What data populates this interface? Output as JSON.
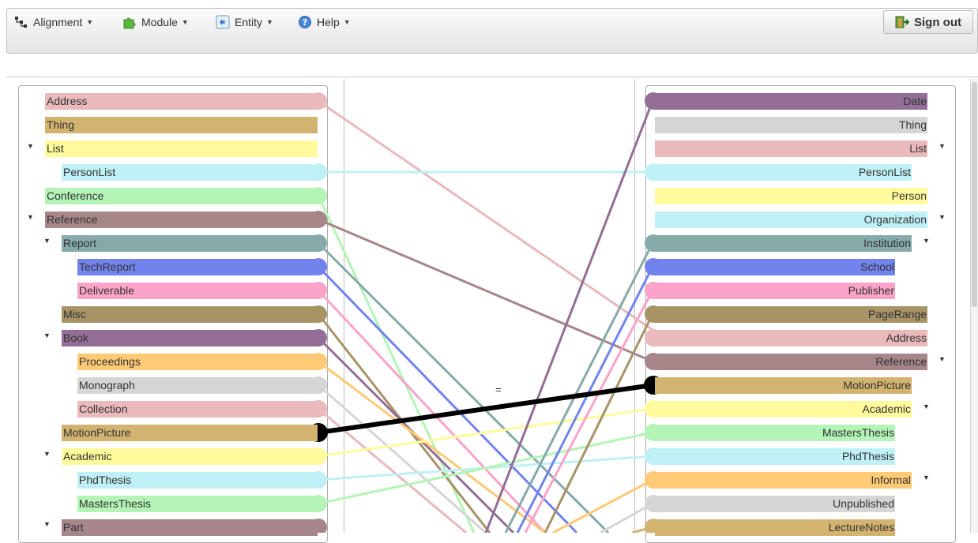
{
  "toolbar": {
    "menus": [
      {
        "label": "Alignment",
        "icon": "alignment-tree-icon"
      },
      {
        "label": "Module",
        "icon": "puzzle-piece-icon"
      },
      {
        "label": "Entity",
        "icon": "entity-icon"
      },
      {
        "label": "Help",
        "icon": "help-icon"
      }
    ],
    "sign_out": {
      "label": "Sign out",
      "icon": "exit-door-icon"
    }
  },
  "mapping_label": "=",
  "colors": {
    "pink": "#e9b9bb",
    "gold": "#d3b370",
    "yellow": "#fffa9c",
    "cyan": "#bff0f5",
    "green": "#b4f4b6",
    "mauve": "#a68689",
    "teal": "#86aaaa",
    "blue": "#7283ee",
    "rose": "#fba3c9",
    "olive": "#a79366",
    "purple": "#946e96",
    "orange": "#ffca75",
    "grey": "#d5d5d5"
  },
  "left_tree": [
    {
      "label": "Address",
      "color": "pink",
      "toggle": false
    },
    {
      "label": "Thing",
      "color": "gold",
      "toggle": false
    },
    {
      "label": "List",
      "color": "yellow",
      "toggle": true
    },
    {
      "label": "PersonList",
      "color": "cyan",
      "toggle": false
    },
    {
      "label": "Conference",
      "color": "green",
      "toggle": false
    },
    {
      "label": "Reference",
      "color": "mauve",
      "toggle": true
    },
    {
      "label": "Report",
      "color": "teal",
      "toggle": true
    },
    {
      "label": "TechReport",
      "color": "blue",
      "toggle": false
    },
    {
      "label": "Deliverable",
      "color": "rose",
      "toggle": false
    },
    {
      "label": "Misc",
      "color": "olive",
      "toggle": false
    },
    {
      "label": "Book",
      "color": "purple",
      "toggle": true
    },
    {
      "label": "Proceedings",
      "color": "orange",
      "toggle": false
    },
    {
      "label": "Monograph",
      "color": "grey",
      "toggle": false
    },
    {
      "label": "Collection",
      "color": "pink",
      "toggle": false
    },
    {
      "label": "MotionPicture",
      "color": "gold",
      "toggle": false
    },
    {
      "label": "Academic",
      "color": "yellow",
      "toggle": true
    },
    {
      "label": "PhdThesis",
      "color": "cyan",
      "toggle": false
    },
    {
      "label": "MastersThesis",
      "color": "green",
      "toggle": false
    },
    {
      "label": "Part",
      "color": "mauve",
      "toggle": true
    }
  ],
  "right_tree": [
    {
      "label": "Date",
      "color": "purple",
      "toggle": false
    },
    {
      "label": "Thing",
      "color": "grey",
      "toggle": false
    },
    {
      "label": "List",
      "color": "pink",
      "toggle": true
    },
    {
      "label": "PersonList",
      "color": "cyan",
      "toggle": false
    },
    {
      "label": "Person",
      "color": "yellow",
      "toggle": false
    },
    {
      "label": "Organization",
      "color": "cyan",
      "toggle": true
    },
    {
      "label": "Institution",
      "color": "teal",
      "toggle": true
    },
    {
      "label": "School",
      "color": "blue",
      "toggle": false
    },
    {
      "label": "Publisher",
      "color": "rose",
      "toggle": false
    },
    {
      "label": "PageRange",
      "color": "olive",
      "toggle": false
    },
    {
      "label": "Address",
      "color": "pink",
      "toggle": false
    },
    {
      "label": "Reference",
      "color": "mauve",
      "toggle": true
    },
    {
      "label": "MotionPicture",
      "color": "gold",
      "toggle": false
    },
    {
      "label": "Academic",
      "color": "yellow",
      "toggle": true
    },
    {
      "label": "MastersThesis",
      "color": "green",
      "toggle": false
    },
    {
      "label": "PhdThesis",
      "color": "cyan",
      "toggle": false
    },
    {
      "label": "Informal",
      "color": "orange",
      "toggle": true
    },
    {
      "label": "Unpublished",
      "color": "grey",
      "toggle": false
    },
    {
      "label": "LectureNotes",
      "color": "gold",
      "toggle": false
    }
  ]
}
